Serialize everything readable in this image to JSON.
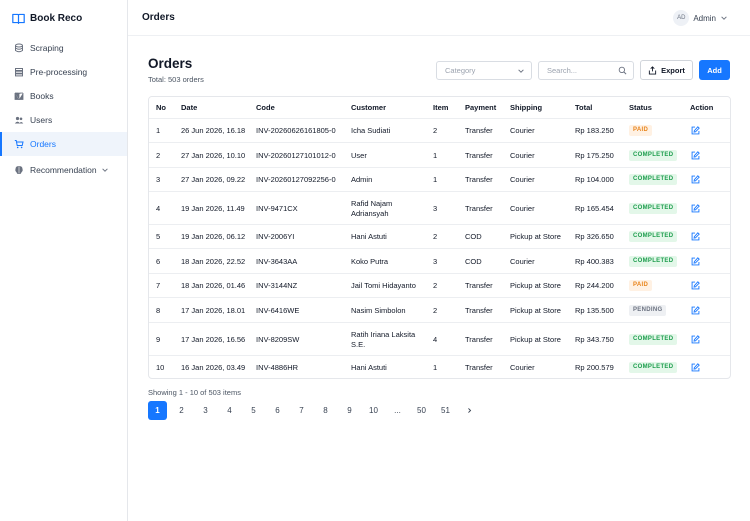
{
  "app": {
    "name": "Book Reco"
  },
  "sidebar": {
    "items": [
      {
        "label": "Scraping",
        "icon": "database-icon"
      },
      {
        "label": "Pre-processing",
        "icon": "stack-icon"
      },
      {
        "label": "Books",
        "icon": "book-icon"
      },
      {
        "label": "Users",
        "icon": "users-icon"
      },
      {
        "label": "Orders",
        "icon": "cart-icon",
        "active": true
      },
      {
        "label": "Recommendation",
        "icon": "brain-icon",
        "expandable": true
      }
    ]
  },
  "header": {
    "title": "Orders",
    "user": {
      "initials": "AD",
      "name": "Admin"
    }
  },
  "main": {
    "title": "Orders",
    "total": "Total: 503 orders",
    "category_placeholder": "Category",
    "search_placeholder": "Search...",
    "export_label": "Export",
    "add_label": "Add"
  },
  "table": {
    "columns": [
      "No",
      "Date",
      "Code",
      "Customer",
      "Item",
      "Payment",
      "Shipping",
      "Total",
      "Status",
      "Action"
    ],
    "rows": [
      {
        "no": "1",
        "date": "26 Jun 2026, 16.18",
        "code": "INV-20260626161805-0",
        "customer": [
          "Icha Sudiati"
        ],
        "item": "2",
        "payment": "Transfer",
        "shipping": "Courier",
        "total": "Rp 183.250",
        "status": "PAID"
      },
      {
        "no": "2",
        "date": "27 Jan 2026, 10.10",
        "code": "INV-20260127101012-0",
        "customer": [
          "User"
        ],
        "item": "1",
        "payment": "Transfer",
        "shipping": "Courier",
        "total": "Rp 175.250",
        "status": "COMPLETED"
      },
      {
        "no": "3",
        "date": "27 Jan 2026, 09.22",
        "code": "INV-20260127092256-0",
        "customer": [
          "Admin"
        ],
        "item": "1",
        "payment": "Transfer",
        "shipping": "Courier",
        "total": "Rp 104.000",
        "status": "COMPLETED"
      },
      {
        "no": "4",
        "date": "19 Jan 2026, 11.49",
        "code": "INV-9471CX",
        "customer": [
          "Rafid Najam",
          "Adriansyah"
        ],
        "item": "3",
        "payment": "Transfer",
        "shipping": "Courier",
        "total": "Rp 165.454",
        "status": "COMPLETED"
      },
      {
        "no": "5",
        "date": "19 Jan 2026, 06.12",
        "code": "INV-2006YI",
        "customer": [
          "Hani Astuti"
        ],
        "item": "2",
        "payment": "COD",
        "shipping": "Pickup at Store",
        "total": "Rp 326.650",
        "status": "COMPLETED"
      },
      {
        "no": "6",
        "date": "18 Jan 2026, 22.52",
        "code": "INV-3643AA",
        "customer": [
          "Koko Putra"
        ],
        "item": "3",
        "payment": "COD",
        "shipping": "Courier",
        "total": "Rp 400.383",
        "status": "COMPLETED"
      },
      {
        "no": "7",
        "date": "18 Jan 2026, 01.46",
        "code": "INV-3144NZ",
        "customer": [
          "Jail Tomi Hidayanto"
        ],
        "item": "2",
        "payment": "Transfer",
        "shipping": "Pickup at Store",
        "total": "Rp 244.200",
        "status": "PAID"
      },
      {
        "no": "8",
        "date": "17 Jan 2026, 18.01",
        "code": "INV-6416WE",
        "customer": [
          "Nasim Simbolon"
        ],
        "item": "2",
        "payment": "Transfer",
        "shipping": "Pickup at Store",
        "total": "Rp 135.500",
        "status": "PENDING"
      },
      {
        "no": "9",
        "date": "17 Jan 2026, 16.56",
        "code": "INV-8209SW",
        "customer": [
          "Ratih Iriana Laksita",
          "S.E."
        ],
        "item": "4",
        "payment": "Transfer",
        "shipping": "Pickup at Store",
        "total": "Rp 343.750",
        "status": "COMPLETED"
      },
      {
        "no": "10",
        "date": "16 Jan 2026, 03.49",
        "code": "INV-4886HR",
        "customer": [
          "Hani Astuti"
        ],
        "item": "1",
        "payment": "Transfer",
        "shipping": "Courier",
        "total": "Rp 200.579",
        "status": "COMPLETED"
      }
    ]
  },
  "pagination": {
    "showing": "Showing 1 - 10 of 503 items",
    "pages": [
      "1",
      "2",
      "3",
      "4",
      "5",
      "6",
      "7",
      "8",
      "9",
      "10",
      "...",
      "50",
      "51"
    ],
    "current": "1"
  },
  "colors": {
    "primary": "#1677ff",
    "paid": "#e8831a",
    "completed": "#1e9e4e",
    "pending": "#6b7280"
  }
}
